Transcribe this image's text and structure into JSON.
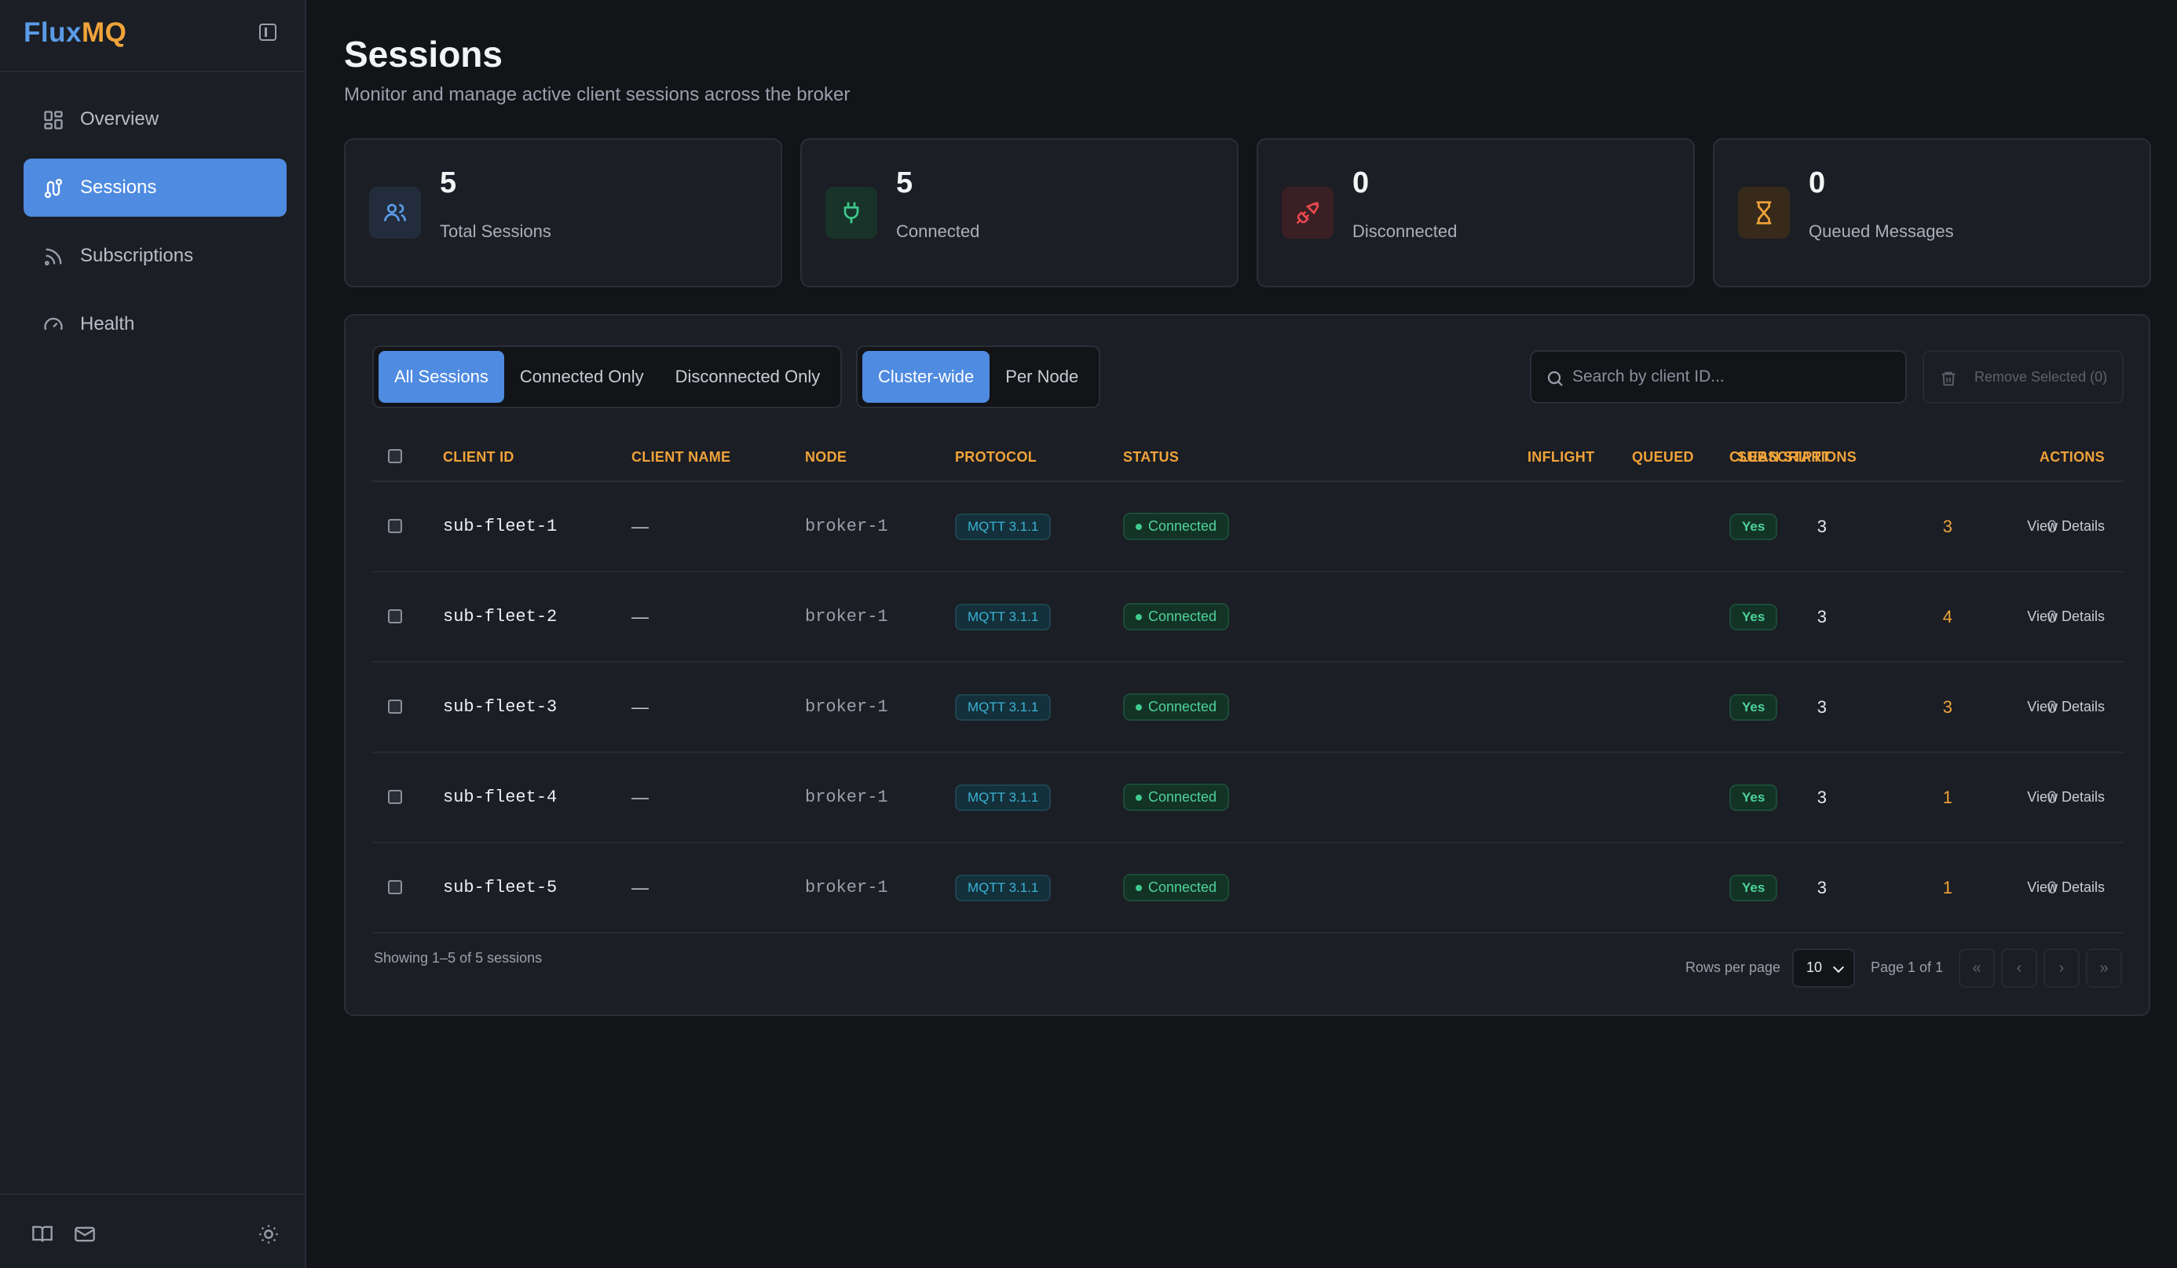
{
  "app": {
    "logo_part1": "Flux",
    "logo_part2": "MQ"
  },
  "sidebar": {
    "items": [
      {
        "label": "Overview",
        "icon": "layout-grid-icon",
        "active": false
      },
      {
        "label": "Sessions",
        "icon": "route-icon",
        "active": true
      },
      {
        "label": "Subscriptions",
        "icon": "rss-icon",
        "active": false
      },
      {
        "label": "Health",
        "icon": "gauge-icon",
        "active": false
      }
    ],
    "footer_icons": [
      "book-icon",
      "mail-icon",
      "sun-icon"
    ]
  },
  "header": {
    "title": "Sessions",
    "subtitle": "Monitor and manage active client sessions across the broker"
  },
  "stats": [
    {
      "value": "5",
      "label": "Total Sessions",
      "icon": "users-icon",
      "color": "#5b9be8",
      "bg": "#222c3c"
    },
    {
      "value": "5",
      "label": "Connected",
      "icon": "plug-icon",
      "color": "#3ecb8c",
      "bg": "#18332a"
    },
    {
      "value": "0",
      "label": "Disconnected",
      "icon": "unplug-icon",
      "color": "#e5484d",
      "bg": "#3a1f24"
    },
    {
      "value": "0",
      "label": "Queued Messages",
      "icon": "hourglass-icon",
      "color": "#f0a33a",
      "bg": "#372a1b"
    }
  ],
  "filters": {
    "scope": [
      "All Sessions",
      "Connected Only",
      "Disconnected Only"
    ],
    "scope_selected": "All Sessions",
    "view": [
      "Cluster-wide",
      "Per Node"
    ],
    "view_selected": "Cluster-wide"
  },
  "search": {
    "placeholder": "Search by client ID..."
  },
  "remove_button": "Remove Selected (0)",
  "table": {
    "columns": [
      "CLIENT ID",
      "CLIENT NAME",
      "NODE",
      "PROTOCOL",
      "STATUS",
      "SUBSCRIPTIONS",
      "INFLIGHT",
      "QUEUED",
      "CLEAN START",
      "ACTIONS"
    ],
    "rows": [
      {
        "client_id": "sub-fleet-1",
        "client_name": "—",
        "node": "broker-1",
        "protocol": "MQTT 3.1.1",
        "status": "Connected",
        "subscriptions": "3",
        "inflight": "3",
        "queued": "0",
        "clean_start": "Yes",
        "action": "View Details"
      },
      {
        "client_id": "sub-fleet-2",
        "client_name": "—",
        "node": "broker-1",
        "protocol": "MQTT 3.1.1",
        "status": "Connected",
        "subscriptions": "3",
        "inflight": "4",
        "queued": "0",
        "clean_start": "Yes",
        "action": "View Details"
      },
      {
        "client_id": "sub-fleet-3",
        "client_name": "—",
        "node": "broker-1",
        "protocol": "MQTT 3.1.1",
        "status": "Connected",
        "subscriptions": "3",
        "inflight": "3",
        "queued": "0",
        "clean_start": "Yes",
        "action": "View Details"
      },
      {
        "client_id": "sub-fleet-4",
        "client_name": "—",
        "node": "broker-1",
        "protocol": "MQTT 3.1.1",
        "status": "Connected",
        "subscriptions": "3",
        "inflight": "1",
        "queued": "0",
        "clean_start": "Yes",
        "action": "View Details"
      },
      {
        "client_id": "sub-fleet-5",
        "client_name": "—",
        "node": "broker-1",
        "protocol": "MQTT 3.1.1",
        "status": "Connected",
        "subscriptions": "3",
        "inflight": "1",
        "queued": "0",
        "clean_start": "Yes",
        "action": "View Details"
      }
    ]
  },
  "pagination": {
    "showing": "Showing 1–5 of 5 sessions",
    "rows_per_page_label": "Rows per page",
    "rows_per_page": "10",
    "page_label": "Page 1 of 1",
    "buttons": [
      "«",
      "‹",
      "›",
      "»"
    ]
  }
}
